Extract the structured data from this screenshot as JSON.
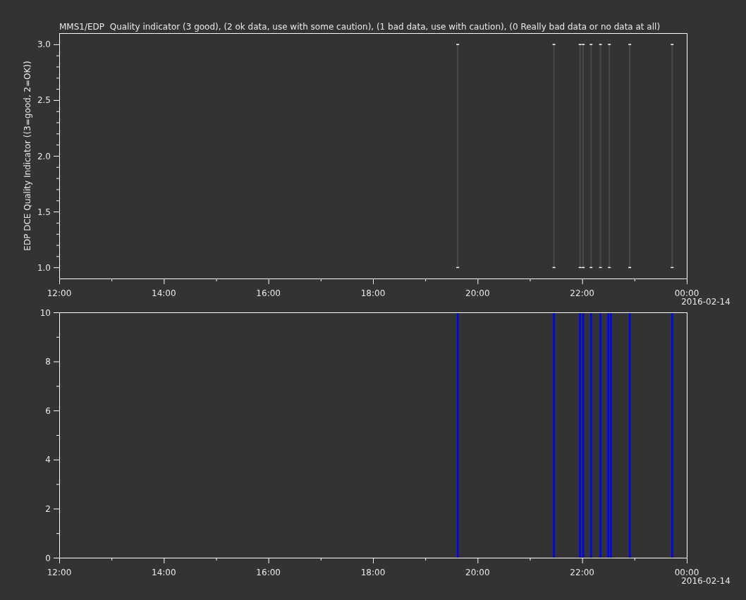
{
  "title": "MMS1/EDP  Quality indicator (3 good), (2 ok data, use with some caution), (1 bad data, use with caution), (0 Really bad data or no data at all)",
  "panels": [
    {
      "date_label": "2016-02-14",
      "chart_data": {
        "type": "scatter",
        "ylabel": "EDP DCE Quality Indicator ((3=good, 2=OK))",
        "xlim": [
          12,
          24
        ],
        "ylim": [
          0.9,
          3.1
        ],
        "x": [
          19.62,
          19.62,
          21.46,
          21.46,
          21.96,
          21.96,
          22.02,
          22.02,
          22.17,
          22.17,
          22.35,
          22.35,
          22.52,
          22.52,
          22.91,
          22.91,
          23.72,
          23.72
        ],
        "series": [
          {
            "color": "#ffffff",
            "values": [
              3,
              1,
              3,
              1,
              3,
              1,
              3,
              1,
              3,
              1,
              3,
              1,
              3,
              1,
              3,
              1,
              3,
              1
            ]
          }
        ],
        "xticks": [
          {
            "value": 12,
            "label": "12:00"
          },
          {
            "value": 14,
            "label": "14:00"
          },
          {
            "value": 16,
            "label": "16:00"
          },
          {
            "value": 18,
            "label": "18:00"
          },
          {
            "value": 20,
            "label": "20:00"
          },
          {
            "value": 22,
            "label": "22:00"
          },
          {
            "value": 24,
            "label": "00:00"
          }
        ],
        "yticks": [
          {
            "value": 1,
            "label": "1.0"
          },
          {
            "value": 1.5,
            "label": "1.5"
          },
          {
            "value": 2,
            "label": "2.0"
          },
          {
            "value": 2.5,
            "label": "2.5"
          },
          {
            "value": 3,
            "label": "3.0"
          }
        ]
      }
    },
    {
      "date_label": "2016-02-14",
      "chart_data": {
        "type": "bar",
        "xlim": [
          12,
          24
        ],
        "ylim": [
          0,
          10
        ],
        "x": [
          19.62,
          21.46,
          21.96,
          22.02,
          22.17,
          22.35,
          22.5,
          22.55,
          22.91,
          23.72
        ],
        "series": [
          {
            "color": "#0000ff",
            "values": [
              10,
              10,
              10,
              10,
              10,
              10,
              10,
              10,
              10,
              10
            ]
          }
        ],
        "xticks": [
          {
            "value": 12,
            "label": "12:00"
          },
          {
            "value": 14,
            "label": "14:00"
          },
          {
            "value": 16,
            "label": "16:00"
          },
          {
            "value": 18,
            "label": "18:00"
          },
          {
            "value": 20,
            "label": "20:00"
          },
          {
            "value": 22,
            "label": "22:00"
          },
          {
            "value": 24,
            "label": "00:00"
          }
        ],
        "yticks": [
          0,
          2,
          4,
          6,
          8,
          10
        ]
      }
    }
  ]
}
